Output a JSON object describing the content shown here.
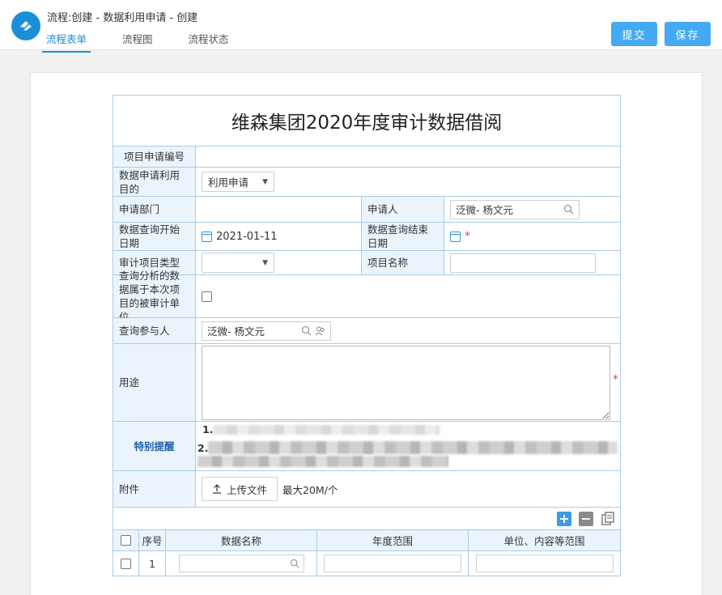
{
  "header": {
    "title": "流程:创建 - 数据利用申请 - 创建",
    "tabs": [
      {
        "label": "流程表单",
        "active": true
      },
      {
        "label": "流程图",
        "active": false
      },
      {
        "label": "流程状态",
        "active": false
      }
    ],
    "submit_label": "提交",
    "save_label": "保存",
    "accent_color": "#1a8fd8",
    "button_color": "#45aaf2"
  },
  "form": {
    "title": "维森集团2020年度审计数据借阅",
    "fields": {
      "project_no": {
        "label": "项目申请编号",
        "value": ""
      },
      "purpose_type": {
        "label": "数据申请利用目的",
        "value": "利用申请"
      },
      "department": {
        "label": "申请部门",
        "value": ""
      },
      "applicant": {
        "label": "申请人",
        "value": "泛微- 杨文元"
      },
      "start_date": {
        "label": "数据查询开始日期",
        "value": "2021-01-11"
      },
      "end_date": {
        "label": "数据查询结束日期",
        "value": "",
        "required_mark": "*"
      },
      "audit_type": {
        "label": "审计项目类型",
        "value": ""
      },
      "project_name": {
        "label": "项目名称",
        "value": ""
      },
      "audited_unit": {
        "label": "查询分析的数据属于本次项目的被审计单位",
        "checked": false
      },
      "participants": {
        "label": "查询参与人",
        "value": "泛微- 杨文元"
      },
      "usage": {
        "label": "用途",
        "value": "",
        "required_mark": "*"
      },
      "reminder": {
        "label": "特别提醒",
        "item1": "1.",
        "item2": "2."
      },
      "attachment": {
        "label": "附件",
        "upload_label": "上传文件",
        "limit": "最大20M/个"
      }
    },
    "detail": {
      "columns": [
        "序号",
        "数据名称",
        "年度范围",
        "单位、内容等范围"
      ],
      "rows": [
        {
          "index": "1",
          "name": "",
          "year_range": "",
          "scope": ""
        }
      ]
    }
  }
}
